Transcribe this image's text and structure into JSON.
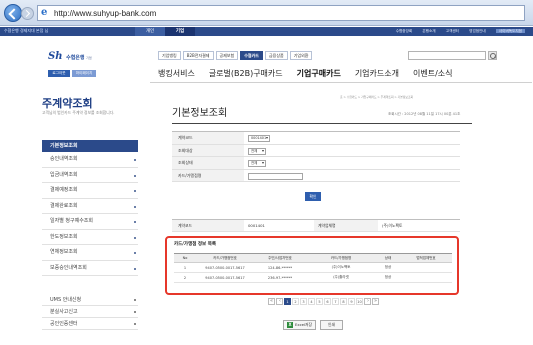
{
  "browser": {
    "url": "http://www.suhyup-bank.com",
    "ie_icon_glyph": "e"
  },
  "topstrip": {
    "bank_tagline": "수협은행 경제지대 본점 님",
    "tab_personal": "개인",
    "tab_corporate": "기업",
    "links": [
      "수협중앙회",
      "은행소개",
      "고객센터",
      "영업점안내",
      "사이버독도지점"
    ]
  },
  "header": {
    "logo_mark": "Sh",
    "logo_name": "수협은행",
    "logo_suffix": "기업",
    "login_label": "로그아웃",
    "mypage_label": "마이페이지",
    "top_menu": [
      "기업뱅킹",
      "B2B전자결제",
      "공제보험",
      "수협카드",
      "금융상품",
      "기업외환"
    ],
    "active_top_menu": "수협카드",
    "search_placeholder": ""
  },
  "gnb": {
    "items": [
      "뱅킹서비스",
      "글로벌(B2B)구매카드",
      "기업구매카드",
      "기업카드소개",
      "이벤트/소식"
    ],
    "active": "기업구매카드"
  },
  "sidebar": {
    "title": "주계약조회",
    "subtitle": "고객님의 법인카드 주계약 정보를 조회합니다.",
    "section_head": "기본정보조회",
    "items": [
      "승인내역조회",
      "입금내역조회",
      "결제예정조회",
      "결제완료조회",
      "일자별 청구예수조회",
      "한도정보조회",
      "연체정보조회",
      "보증승인내역조회"
    ],
    "bottom_items": [
      "UMS 안내신청",
      "분실사고신고",
      "공인인증센터"
    ]
  },
  "content": {
    "page_title": "기본정보조회",
    "breadcrumb": "홈 > 수협카드 > 기업구매카드 > 주계약조회 > 기본정보조회",
    "timestamp": "조회시간 : 2012년 08월 11일 17시 00분 41초",
    "form": {
      "contract_label": "계약코드",
      "contract_value": "0001401",
      "target_label": "조회대상",
      "target_value": "전체",
      "status_label": "조회상태",
      "status_value": "전체",
      "card_label": "카드/가맹점명",
      "card_value": "",
      "query_button": "확인"
    },
    "info": {
      "contract_label": "계약코드",
      "contract_value": "0001401",
      "company_label": "계약업체명",
      "company_value": "(주)이노팩토"
    },
    "list": {
      "title": "카드/가맹점 정보 목록",
      "headers": [
        "No",
        "카드/가맹점번호",
        "주민/사업자번호",
        "카드/가맹점명",
        "상태",
        "법적업체번호"
      ],
      "rows": [
        [
          "1",
          "9407-0500-0017-5617",
          "124-86-******",
          "(주)이노팩토",
          "정상",
          ""
        ],
        [
          "2",
          "9407-0500-0017-5617",
          "236-97-******",
          "(주)홀라넷",
          "정상",
          ""
        ]
      ]
    },
    "pager": {
      "pages": [
        "1",
        "2",
        "3",
        "4",
        "5",
        "6",
        "7",
        "8",
        "9",
        "10"
      ],
      "current": "1"
    },
    "excel_button": "Excel저장",
    "excel_icon_glyph": "X",
    "print_button": "인쇄"
  },
  "colors": {
    "brand_navy": "#2b4a8a",
    "highlight_red": "#e6372a",
    "button_blue": "#2e5eae"
  }
}
